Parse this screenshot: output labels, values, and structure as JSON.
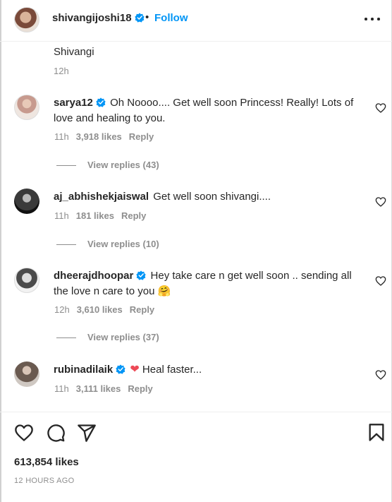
{
  "post": {
    "username": "shivangijoshi18",
    "separator": "•",
    "follow_label": "Follow",
    "caption": "Shivangi",
    "caption_time": "12h",
    "likes": "613,854 likes",
    "timestamp": "12 HOURS AGO"
  },
  "comments": [
    {
      "username": "sarya12",
      "verified": true,
      "text": "Oh Noooo.... Get well soon Princess! Really! Lots of love and healing to you.",
      "time": "11h",
      "likes": "3,918 likes",
      "reply_label": "Reply",
      "view_replies": "View replies (43)"
    },
    {
      "username": "aj_abhishekjaiswal",
      "verified": false,
      "text": "Get well soon shivangi....",
      "time": "11h",
      "likes": "181 likes",
      "reply_label": "Reply",
      "view_replies": "View replies (10)"
    },
    {
      "username": "dheerajdhoopar",
      "verified": true,
      "text": "Hey take care n get well soon .. sending all the love n care to you 🤗",
      "time": "12h",
      "likes": "3,610 likes",
      "reply_label": "Reply",
      "view_replies": "View replies (37)"
    },
    {
      "username": "rubinadilaik",
      "verified": true,
      "text": "❤ Heal faster...",
      "time": "11h",
      "likes": "3,111 likes",
      "reply_label": "Reply"
    }
  ],
  "colors": {
    "accent": "#0095f6",
    "verified": "#0095f6",
    "text": "#262626",
    "muted": "#8e8e8e",
    "heart": "#ed4956"
  },
  "icons": [
    "more-options-icon",
    "verified-badge-icon",
    "heart-outline-icon",
    "comment-icon",
    "share-icon",
    "bookmark-icon"
  ]
}
